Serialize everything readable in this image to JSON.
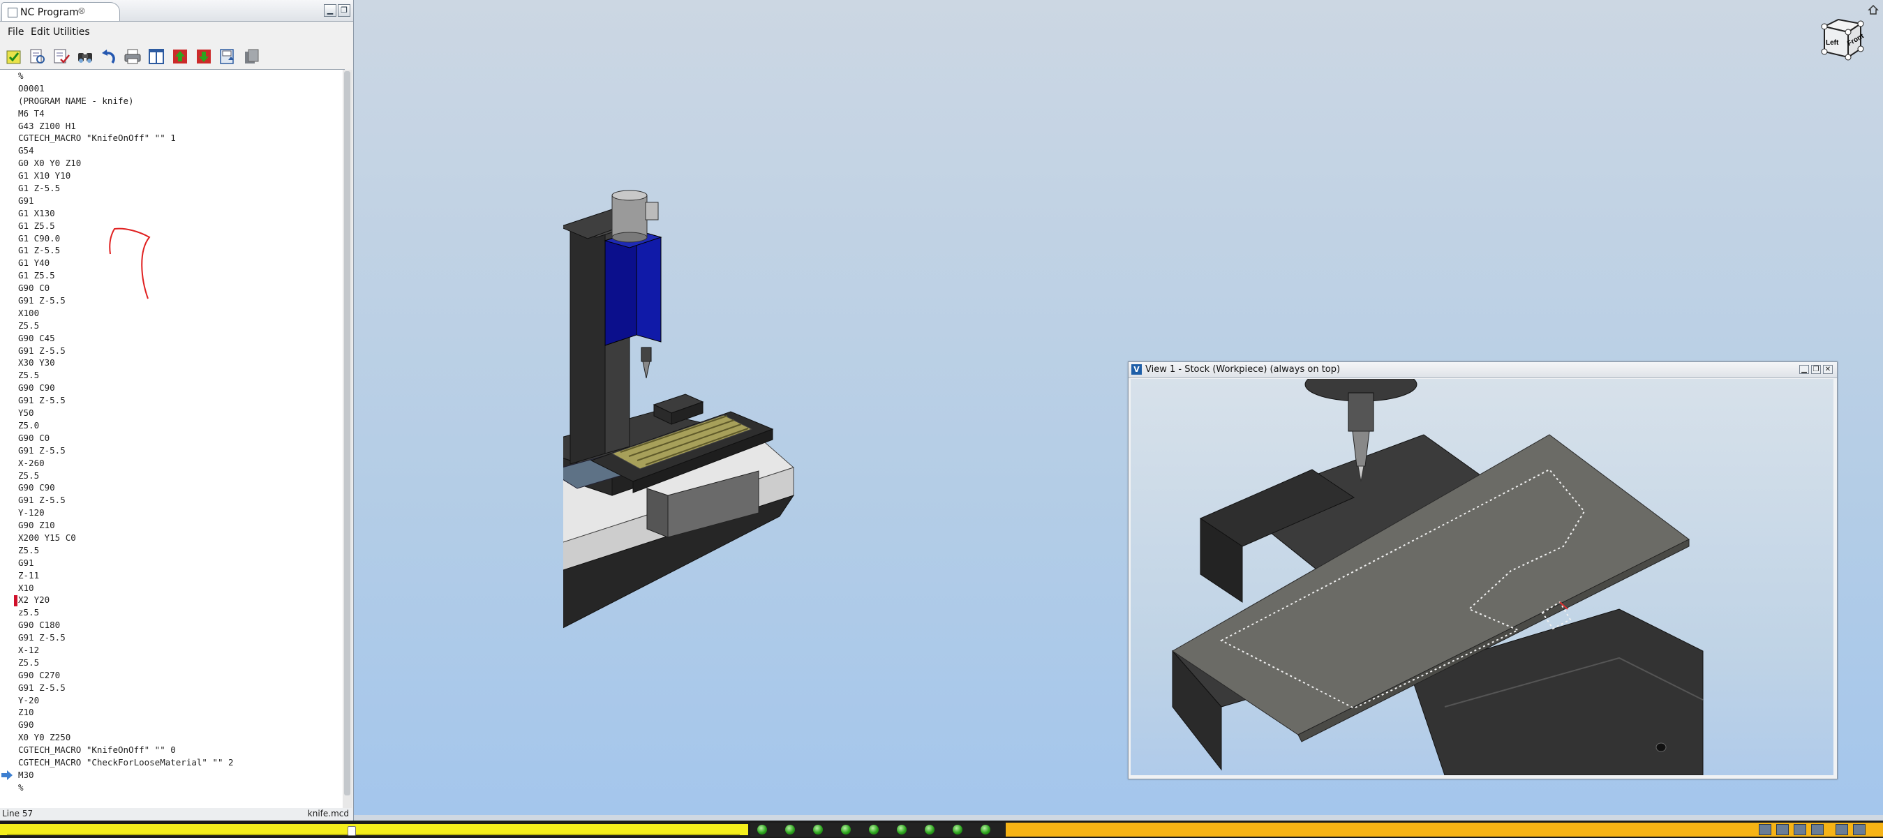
{
  "nc_panel": {
    "tab_title": "NC Program",
    "menu": [
      "File",
      "Edit",
      "Utilities"
    ],
    "toolbar_icons": [
      "check-icon",
      "search-file-icon",
      "verify-icon",
      "binoculars-icon",
      "undo-icon",
      "print-icon",
      "columns-icon",
      "step-back-icon",
      "step-forward-icon",
      "save-icon",
      "clipboard-icon"
    ],
    "code": [
      "%",
      "O0001",
      "(PROGRAM NAME - knife)",
      "M6 T4",
      "G43 Z100 H1",
      "CGTECH_MACRO \"KnifeOnOff\" \"\" 1",
      "G54",
      "G0 X0 Y0 Z10",
      "G1 X10 Y10",
      "G1 Z-5.5",
      "G91",
      "G1 X130",
      "G1 Z5.5",
      "G1 C90.0",
      "G1 Z-5.5",
      "G1 Y40",
      "G1 Z5.5",
      "G90 C0",
      "G91 Z-5.5",
      "X100",
      "Z5.5",
      "G90 C45",
      "G91 Z-5.5",
      "X30 Y30",
      "Z5.5",
      "G90 C90",
      "G91 Z-5.5",
      "Y50",
      "Z5.0",
      "G90 C0",
      "G91 Z-5.5",
      "X-260",
      "Z5.5",
      "G90 C90",
      "G91 Z-5.5",
      "Y-120",
      "G90 Z10",
      "X200 Y15 C0",
      "Z5.5",
      "G91",
      "Z-11",
      "X10",
      "X2 Y20",
      "z5.5",
      "G90 C180",
      "G91 Z-5.5",
      "X-12",
      "Z5.5",
      "G90 C270",
      "G91 Z-5.5",
      "Y-20",
      "Z10",
      "G90",
      "X0 Y0 Z250",
      "CGTECH_MACRO \"KnifeOnOff\" \"\" 0",
      "CGTECH_MACRO \"CheckForLooseMaterial\" \"\" 2",
      "M30",
      "%"
    ],
    "marked_line_index": 42,
    "current_line_index": 56,
    "status_line": "Line 57",
    "status_file": "knife.mcd"
  },
  "stock_window": {
    "title": "View 1 - Stock (Workpiece) (always on top)",
    "icon_label": "V"
  },
  "view_cube": {
    "left_label": "Left",
    "front_label": "Front"
  },
  "bottom_bar": {
    "light_count": 9,
    "colors": {
      "progress": "#f4ee1c",
      "status": "#f6b315",
      "light": "#2da51e"
    }
  }
}
